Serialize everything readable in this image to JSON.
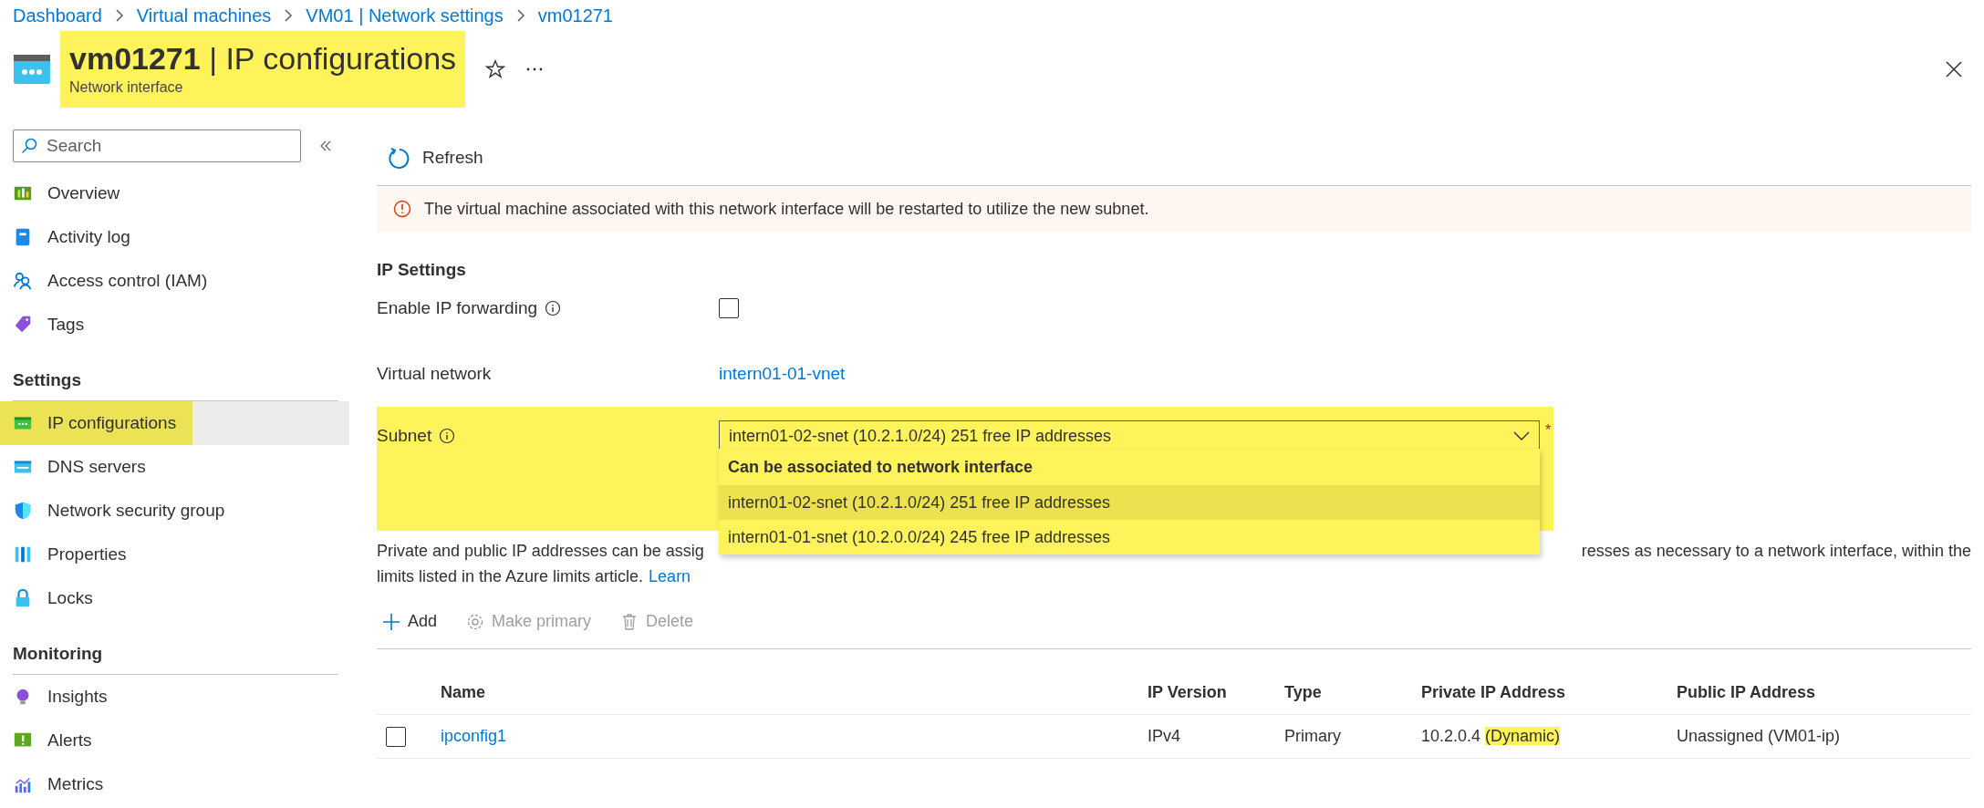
{
  "breadcrumb": [
    "Dashboard",
    "Virtual machines",
    "VM01 | Network settings",
    "vm01271"
  ],
  "header": {
    "title": "**vm01271** | IP configurations",
    "subtitle": "Network interface",
    "highlighted": true
  },
  "sidebar": {
    "search": {
      "placeholder": "Search"
    },
    "groups": [
      {
        "items": [
          {
            "label": "Overview",
            "kind": "overview",
            "selected": false,
            "highlighted": false
          },
          {
            "label": "Activity log",
            "kind": "log",
            "selected": false,
            "highlighted": false
          },
          {
            "label": "Access control (IAM)",
            "kind": "iam",
            "selected": false,
            "highlighted": false
          },
          {
            "label": "Tags",
            "kind": "tag",
            "selected": false,
            "highlighted": false
          }
        ]
      },
      {
        "title": "Settings",
        "items": [
          {
            "label": "IP configurations",
            "kind": "ipconfig",
            "selected": true,
            "highlighted": true
          },
          {
            "label": "DNS servers",
            "kind": "dns",
            "selected": false,
            "highlighted": false
          },
          {
            "label": "Network security group",
            "kind": "shield",
            "selected": false,
            "highlighted": false
          },
          {
            "label": "Properties",
            "kind": "props",
            "selected": false,
            "highlighted": false
          },
          {
            "label": "Locks",
            "kind": "lock",
            "selected": false,
            "highlighted": false
          }
        ]
      },
      {
        "title": "Monitoring",
        "items": [
          {
            "label": "Insights",
            "kind": "bulb",
            "selected": false,
            "highlighted": false
          },
          {
            "label": "Alerts",
            "kind": "alert",
            "selected": false,
            "highlighted": false
          },
          {
            "label": "Metrics",
            "kind": "metrics",
            "selected": false,
            "highlighted": false
          }
        ]
      }
    ]
  },
  "toolbar": {
    "refresh": "Refresh"
  },
  "warning": "The virtual machine associated with this network interface will be restarted to utilize the new subnet.",
  "ip_settings": {
    "title": "IP Settings",
    "ip_forwarding": {
      "label": "Enable IP forwarding",
      "checked": false
    },
    "virtual_network": {
      "label": "Virtual network",
      "value": "intern01-01-vnet"
    },
    "subnet": {
      "label": "Subnet",
      "value": "intern01-02-snet (10.2.1.0/24) 251 free IP addresses",
      "required": "*",
      "highlighted": true,
      "expanded": true,
      "group_header": "Can be associated to network interface",
      "options": [
        {
          "label": "intern01-02-snet (10.2.1.0/24) 251 free IP addresses",
          "selected": true
        },
        {
          "label": "intern01-01-snet (10.2.0.0/24) 245 free IP addresses",
          "selected": false
        }
      ]
    }
  },
  "description": {
    "line1_left": "Private and public IP addresses can be assig",
    "line1_right": "resses as necessary to a network interface, within the",
    "line2": "limits listed in the Azure limits article.",
    "link": "Learn"
  },
  "actions": [
    {
      "label": "Add",
      "kind": "plus",
      "disabled": false
    },
    {
      "label": "Make primary",
      "kind": "gear",
      "disabled": true
    },
    {
      "label": "Delete",
      "kind": "trash",
      "disabled": true
    }
  ],
  "table": {
    "columns": [
      "Name",
      "IP Version",
      "Type",
      "Private IP Address",
      "Public IP Address"
    ],
    "rows": [
      {
        "selected": false,
        "name": "ipconfig1",
        "ip_version": "IPv4",
        "type": "Primary",
        "private_ip": "10.2.0.4 ",
        "allocation": "(Dynamic)",
        "allocation_highlighted": true,
        "public_ip": "Unassigned (VM01-ip)"
      }
    ]
  }
}
